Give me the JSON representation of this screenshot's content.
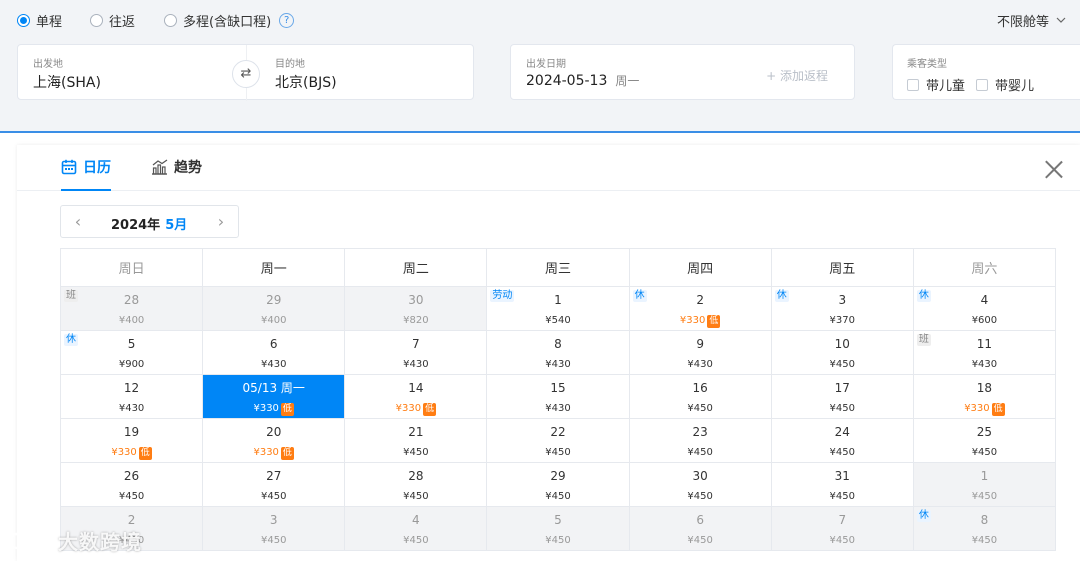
{
  "trip_types": [
    {
      "label": "单程",
      "selected": true
    },
    {
      "label": "往返",
      "selected": false
    },
    {
      "label": "多程(含缺口程)",
      "selected": false
    }
  ],
  "help_icon": "?",
  "cabin_class": "不限舱等",
  "departure": {
    "label": "出发地",
    "value": "上海(SHA)"
  },
  "destination": {
    "label": "目的地",
    "value": "北京(BJS)"
  },
  "swap_icon": "⇄",
  "date": {
    "label": "出发日期",
    "value": "2024-05-13",
    "weekday": "周一",
    "add_return": "+ 添加返程"
  },
  "passenger": {
    "label": "乘客类型",
    "with_child": "带儿童",
    "with_infant": "带婴儿"
  },
  "tabs": {
    "calendar": "日历",
    "trend": "趋势"
  },
  "month_nav": {
    "year": "2024年",
    "month": "5月",
    "prev": "‹",
    "next": "›"
  },
  "weekdays": [
    "周日",
    "周一",
    "周二",
    "周三",
    "周四",
    "周五",
    "周六"
  ],
  "weeks": [
    [
      {
        "day": "28",
        "price": "¥400",
        "out": true,
        "tag": "班",
        "tag_type": "work"
      },
      {
        "day": "29",
        "price": "¥400",
        "out": true
      },
      {
        "day": "30",
        "price": "¥820",
        "out": true
      },
      {
        "day": "1",
        "price": "¥540",
        "tag": "劳动",
        "tag_type": "holiday"
      },
      {
        "day": "2",
        "price": "¥330",
        "low": true,
        "tag": "休",
        "tag_type": "holiday"
      },
      {
        "day": "3",
        "price": "¥370",
        "tag": "休",
        "tag_type": "holiday"
      },
      {
        "day": "4",
        "price": "¥600",
        "tag": "休",
        "tag_type": "holiday"
      }
    ],
    [
      {
        "day": "5",
        "price": "¥900",
        "tag": "休",
        "tag_type": "holiday"
      },
      {
        "day": "6",
        "price": "¥430"
      },
      {
        "day": "7",
        "price": "¥430"
      },
      {
        "day": "8",
        "price": "¥430"
      },
      {
        "day": "9",
        "price": "¥430"
      },
      {
        "day": "10",
        "price": "¥450"
      },
      {
        "day": "11",
        "price": "¥430",
        "tag": "班",
        "tag_type": "work"
      }
    ],
    [
      {
        "day": "12",
        "price": "¥430"
      },
      {
        "day": "05/13 周一",
        "price": "¥330",
        "low": true,
        "selected": true
      },
      {
        "day": "14",
        "price": "¥330",
        "low": true
      },
      {
        "day": "15",
        "price": "¥430"
      },
      {
        "day": "16",
        "price": "¥450"
      },
      {
        "day": "17",
        "price": "¥450"
      },
      {
        "day": "18",
        "price": "¥330",
        "low": true
      }
    ],
    [
      {
        "day": "19",
        "price": "¥330",
        "low": true
      },
      {
        "day": "20",
        "price": "¥330",
        "low": true
      },
      {
        "day": "21",
        "price": "¥450"
      },
      {
        "day": "22",
        "price": "¥450"
      },
      {
        "day": "23",
        "price": "¥450"
      },
      {
        "day": "24",
        "price": "¥450"
      },
      {
        "day": "25",
        "price": "¥450"
      }
    ],
    [
      {
        "day": "26",
        "price": "¥450"
      },
      {
        "day": "27",
        "price": "¥450"
      },
      {
        "day": "28",
        "price": "¥450"
      },
      {
        "day": "29",
        "price": "¥450"
      },
      {
        "day": "30",
        "price": "¥450"
      },
      {
        "day": "31",
        "price": "¥450"
      },
      {
        "day": "1",
        "price": "¥450",
        "out": true
      }
    ],
    [
      {
        "day": "2",
        "price": "¥450",
        "out": true
      },
      {
        "day": "3",
        "price": "¥450",
        "out": true
      },
      {
        "day": "4",
        "price": "¥450",
        "out": true
      },
      {
        "day": "5",
        "price": "¥450",
        "out": true
      },
      {
        "day": "6",
        "price": "¥450",
        "out": true
      },
      {
        "day": "7",
        "price": "¥450",
        "out": true
      },
      {
        "day": "8",
        "price": "¥450",
        "out": true,
        "tag": "休",
        "tag_type": "holiday"
      }
    ]
  ],
  "low_badge": "低",
  "watermark": "大数跨境",
  "colors": {
    "accent": "#0086f6",
    "low_price": "#ff7d13",
    "out_of_month_bg": "#f2f3f5"
  }
}
